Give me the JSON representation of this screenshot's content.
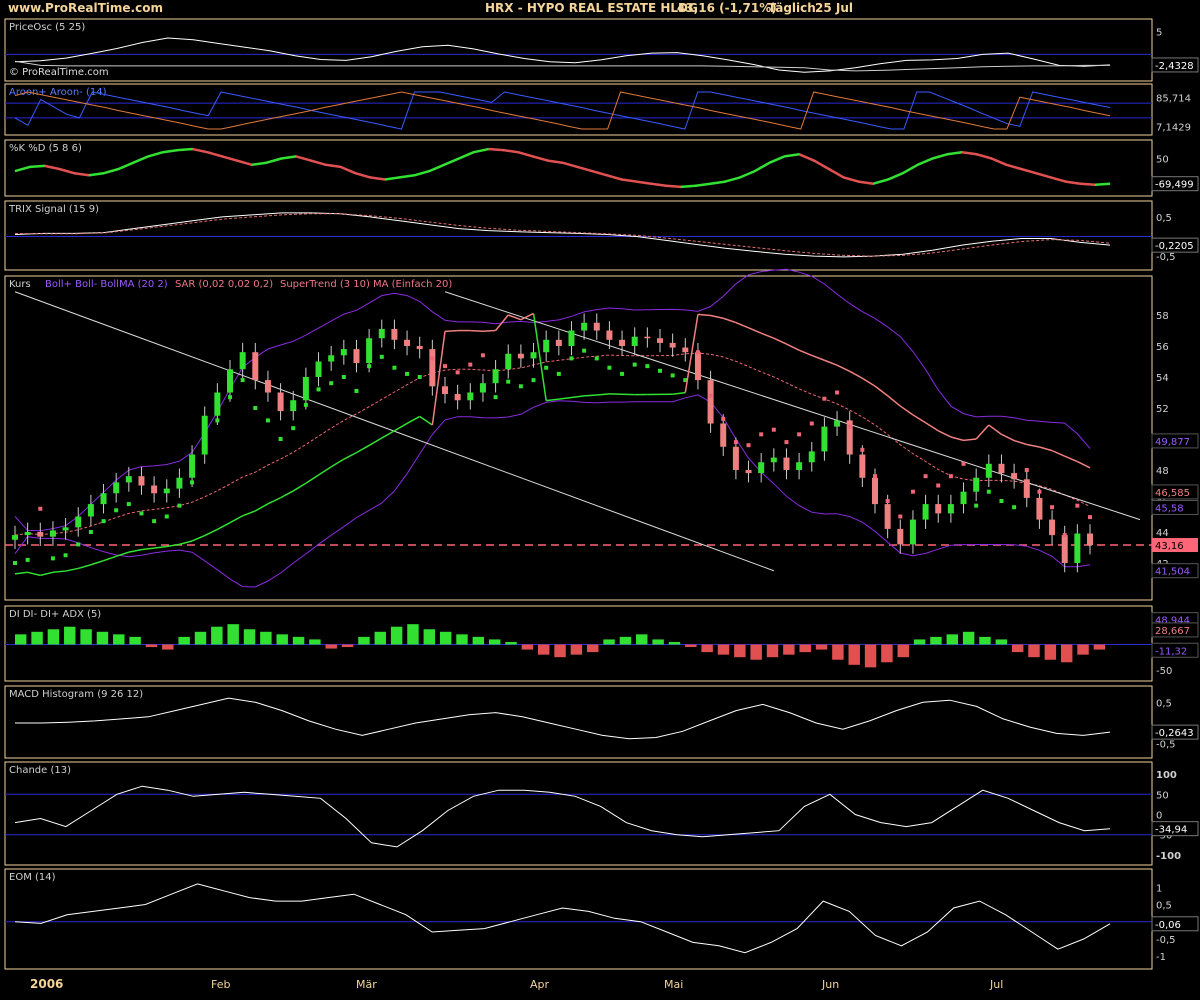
{
  "header": {
    "site": "www.ProRealTime.com",
    "title": "HRX - HYPO REAL ESTATE HLDG",
    "quote": "43,16 (-1,71%)",
    "period": "Täglich",
    "date": "25 Jul"
  },
  "x_axis": {
    "labels": [
      "2006",
      "Feb",
      "Mär",
      "Apr",
      "Mai",
      "Jun",
      "Jul"
    ]
  },
  "colors": {
    "background": "#000000",
    "frame": "#f4d49a",
    "panel_text": "#d0d0d0",
    "blue_line": "#2b2bd6",
    "green": "#31e031",
    "red": "#e05050",
    "purple": "#8a2be2",
    "white": "#ffffff",
    "sar": "#ee6677"
  },
  "chart_data": [
    {
      "id": "priceosc",
      "type": "line",
      "title": "PriceOsc (5 25)",
      "watermark": "© ProRealTime.com",
      "y_ticks": [
        "5"
      ],
      "last_value": "-2,4328",
      "ylim": [
        -4.5,
        6
      ],
      "series": [
        {
          "values": [
            -1.6,
            -1.4,
            -0.8,
            0.2,
            1.3,
            2.6,
            3.6,
            3.2,
            2.4,
            1.6,
            0.8,
            -0.3,
            -1.1,
            -1.3,
            -0.5,
            0.7,
            1.7,
            2.0,
            1.2,
            0.1,
            -0.9,
            -1.6,
            -1.8,
            -1.2,
            -0.3,
            0.3,
            0.4,
            -0.3,
            -1.2,
            -2.2,
            -3.4,
            -3.9,
            -3.6,
            -2.9,
            -2.0,
            -1.3,
            -1.2,
            -0.9,
            0.0,
            0.3,
            -1.0,
            -2.4,
            -2.6,
            -2.3
          ],
          "color": "#ffffff"
        },
        {
          "values": [
            -1.5,
            -2.4,
            -2.5,
            -2.5,
            -2.5,
            -2.5,
            -2.5,
            -2.5,
            -2.5,
            -2.5,
            -2.5,
            -2.5,
            -2.5,
            -2.5,
            -2.5,
            -2.5,
            -2.5,
            -2.5,
            -2.5,
            -2.5,
            -2.5,
            -2.5,
            -2.5,
            -2.5,
            -2.5,
            -2.5,
            -2.5,
            -2.5,
            -2.6,
            -2.7,
            -2.8,
            -2.9,
            -3.4,
            -3.6,
            -3.5,
            -3.3,
            -3.1,
            -2.9,
            -2.7,
            -2.6,
            -2.5,
            -2.5,
            -2.4,
            -2.4
          ],
          "color": "#cccccc"
        }
      ],
      "reference_lines": [
        0
      ]
    },
    {
      "id": "aroon",
      "type": "line",
      "title": "Aroon+ Aroon- (14)",
      "y_ticks": [
        "85,714",
        "7,1429"
      ],
      "ylim": [
        0,
        100
      ],
      "series": [
        {
          "name": "Aroon+",
          "values": [
            30,
            10,
            80,
            60,
            40,
            30,
            100,
            93,
            86,
            79,
            72,
            65,
            58,
            50,
            43,
            36,
            100,
            93,
            86,
            79,
            72,
            65,
            58,
            50,
            43,
            36,
            29,
            22,
            15,
            7,
            0,
            100,
            100,
            100,
            93,
            86,
            79,
            72,
            100,
            93,
            86,
            79,
            72,
            65,
            58,
            50,
            43,
            36,
            29,
            22,
            15,
            7,
            0,
            100,
            100,
            93,
            86,
            79,
            72,
            65,
            58,
            50,
            43,
            36,
            29,
            22,
            15,
            7,
            0,
            0,
            100,
            100,
            86,
            72,
            58,
            43,
            29,
            15,
            7,
            100,
            93,
            86,
            79,
            72,
            65,
            58
          ],
          "color": "#3a5aff"
        },
        {
          "name": "Aroon-",
          "values": [
            90,
            100,
            93,
            86,
            79,
            72,
            65,
            58,
            50,
            43,
            36,
            29,
            22,
            15,
            7,
            0,
            0,
            7,
            15,
            22,
            29,
            36,
            43,
            50,
            58,
            65,
            72,
            79,
            86,
            93,
            100,
            93,
            86,
            79,
            72,
            65,
            58,
            50,
            43,
            36,
            29,
            22,
            15,
            7,
            0,
            0,
            0,
            100,
            93,
            86,
            79,
            72,
            65,
            58,
            50,
            43,
            36,
            29,
            22,
            15,
            7,
            0,
            100,
            93,
            86,
            79,
            72,
            65,
            58,
            50,
            43,
            36,
            29,
            22,
            15,
            7,
            0,
            0,
            86,
            79,
            72,
            65,
            58,
            50,
            43,
            36
          ],
          "color": "#e07a3a"
        }
      ],
      "reference_lines": [
        70,
        30
      ]
    },
    {
      "id": "stoch",
      "type": "line",
      "title": "%K %D (5 8 6)",
      "y_ticks": [
        "50"
      ],
      "last_value": "-69,499",
      "ylim": [
        -100,
        100
      ],
      "series": [
        {
          "name": "%K",
          "values": [
            -10,
            10,
            15,
            0,
            -20,
            -30,
            -20,
            0,
            30,
            60,
            80,
            90,
            95,
            80,
            60,
            40,
            20,
            30,
            50,
            60,
            40,
            20,
            10,
            -20,
            -40,
            -50,
            -40,
            -30,
            -10,
            20,
            50,
            80,
            95,
            90,
            80,
            60,
            40,
            30,
            10,
            -10,
            -30,
            -50,
            -60,
            -70,
            -80,
            -85,
            -80,
            -70,
            -60,
            -40,
            -10,
            30,
            60,
            70,
            40,
            0,
            -40,
            -60,
            -70,
            -50,
            -20,
            20,
            50,
            70,
            80,
            70,
            50,
            20,
            0,
            -20,
            -40,
            -60,
            -70,
            -75,
            -70
          ],
          "color": "#ffffff"
        }
      ]
    },
    {
      "id": "trix",
      "type": "line",
      "title": "TRIX Signal (15 9)",
      "y_ticks": [
        "0,5",
        "-0,5"
      ],
      "last_value": "-0,2205",
      "ylim": [
        -0.7,
        0.7
      ],
      "series": [
        {
          "name": "TRIX",
          "values": [
            0.05,
            0.08,
            0.08,
            0.1,
            0.2,
            0.3,
            0.4,
            0.5,
            0.55,
            0.6,
            0.6,
            0.58,
            0.5,
            0.4,
            0.3,
            0.2,
            0.15,
            0.12,
            0.1,
            0.08,
            0.05,
            0.0,
            -0.1,
            -0.2,
            -0.3,
            -0.38,
            -0.45,
            -0.5,
            -0.52,
            -0.5,
            -0.45,
            -0.35,
            -0.22,
            -0.12,
            -0.05,
            -0.05,
            -0.15,
            -0.22
          ],
          "color": "#ffffff"
        },
        {
          "name": "Signal",
          "values": [
            0.08,
            0.07,
            0.07,
            0.09,
            0.17,
            0.26,
            0.35,
            0.44,
            0.5,
            0.55,
            0.58,
            0.58,
            0.53,
            0.46,
            0.37,
            0.28,
            0.21,
            0.16,
            0.13,
            0.1,
            0.07,
            0.03,
            -0.04,
            -0.12,
            -0.2,
            -0.28,
            -0.36,
            -0.43,
            -0.48,
            -0.5,
            -0.48,
            -0.42,
            -0.32,
            -0.22,
            -0.13,
            -0.08,
            -0.1,
            -0.17
          ],
          "color": "#e07070"
        }
      ],
      "reference_lines": [
        0
      ]
    },
    {
      "id": "price",
      "type": "candlestick",
      "title": "Kurs",
      "legend": [
        "Boll+ Boll- BollMA (20 2)",
        "SAR (0,02 0,02 0,2)",
        "SuperTrend (3 10)",
        "MA (Einfach 20)"
      ],
      "y_ticks": [
        "58",
        "56",
        "54",
        "52",
        "50",
        "48",
        "46",
        "44",
        "42"
      ],
      "value_labels": [
        "49,877",
        "46,585",
        "45,58",
        "43,16",
        "41,504"
      ],
      "ylim": [
        40,
        60
      ],
      "close": [
        43.8,
        44.0,
        43.7,
        44.1,
        44.3,
        45.0,
        45.8,
        46.5,
        47.2,
        47.6,
        47.0,
        46.5,
        46.8,
        47.5,
        49.0,
        51.5,
        53.0,
        54.5,
        55.6,
        53.8,
        53.0,
        51.8,
        52.5,
        54.0,
        55.0,
        55.4,
        55.8,
        54.9,
        56.5,
        57.1,
        56.4,
        56.0,
        55.8,
        53.4,
        52.9,
        52.5,
        53.0,
        53.6,
        54.5,
        55.5,
        55.2,
        55.6,
        56.4,
        56.0,
        57.0,
        57.5,
        57.0,
        56.4,
        56.0,
        56.6,
        56.5,
        56.2,
        55.9,
        55.6,
        53.8,
        51.0,
        49.5,
        48.0,
        47.8,
        48.5,
        48.8,
        48.0,
        48.5,
        49.2,
        50.8,
        51.2,
        49.0,
        47.5,
        45.8,
        44.2,
        43.2,
        44.8,
        45.8,
        45.2,
        45.8,
        46.6,
        47.5,
        48.4,
        47.8,
        47.4,
        46.2,
        44.8,
        43.8,
        42.0,
        43.9,
        43.16
      ],
      "reference_lines": [
        43.16
      ],
      "reference_lines_note": "dashed line at last close"
    },
    {
      "id": "dmi",
      "type": "bar",
      "title": "DI DI- DI+ ADX (5)",
      "y_ticks": [
        "50",
        "-50"
      ],
      "value_labels": [
        "48,944",
        "28,667",
        "-11,32"
      ],
      "ylim": [
        -60,
        60
      ],
      "values": [
        20,
        25,
        30,
        35,
        30,
        25,
        20,
        15,
        -5,
        -10,
        15,
        25,
        35,
        40,
        30,
        25,
        20,
        15,
        10,
        -8,
        -5,
        15,
        25,
        35,
        40,
        30,
        25,
        20,
        15,
        10,
        5,
        -10,
        -20,
        -25,
        -20,
        -15,
        10,
        15,
        20,
        10,
        5,
        -5,
        -15,
        -20,
        -25,
        -30,
        -25,
        -20,
        -15,
        -10,
        -30,
        -40,
        -45,
        -35,
        -25,
        10,
        15,
        20,
        25,
        15,
        10,
        -15,
        -25,
        -30,
        -35,
        -20,
        -10
      ]
    },
    {
      "id": "macd",
      "type": "line",
      "title": "MACD Histogram (9 26 12)",
      "y_ticks": [
        "0,5",
        "-0,5"
      ],
      "last_value": "-0,2643",
      "ylim": [
        -0.7,
        0.7
      ],
      "series": [
        {
          "values": [
            0.0,
            0.0,
            0.02,
            0.05,
            0.1,
            0.15,
            0.3,
            0.45,
            0.6,
            0.5,
            0.3,
            0.05,
            -0.15,
            -0.3,
            -0.15,
            0.0,
            0.1,
            0.2,
            0.25,
            0.15,
            0.0,
            -0.15,
            -0.3,
            -0.38,
            -0.35,
            -0.2,
            0.05,
            0.3,
            0.45,
            0.25,
            0.0,
            -0.15,
            0.05,
            0.3,
            0.5,
            0.55,
            0.4,
            0.1,
            -0.1,
            -0.25,
            -0.3,
            -0.22
          ],
          "color": "#ffffff"
        }
      ]
    },
    {
      "id": "chande",
      "type": "line",
      "title": "Chande (13)",
      "y_ticks": [
        "100",
        "50",
        "0",
        "-50",
        "-100"
      ],
      "last_value": "-34,94",
      "ylim": [
        -110,
        110
      ],
      "series": [
        {
          "values": [
            -20,
            -10,
            -30,
            10,
            50,
            70,
            60,
            45,
            50,
            55,
            50,
            45,
            40,
            -10,
            -70,
            -80,
            -40,
            10,
            45,
            60,
            60,
            55,
            45,
            20,
            -20,
            -40,
            -50,
            -55,
            -50,
            -45,
            -40,
            20,
            50,
            0,
            -20,
            -30,
            -20,
            20,
            60,
            40,
            10,
            -20,
            -40,
            -35
          ],
          "color": "#ffffff"
        }
      ],
      "reference_lines": [
        50,
        -50
      ]
    },
    {
      "id": "eom",
      "type": "line",
      "title": "EOM (14)",
      "y_ticks": [
        "1",
        "0,5",
        "0",
        "-0,5",
        "-1"
      ],
      "last_value": "-0,06",
      "ylim": [
        -1.2,
        1.3
      ],
      "series": [
        {
          "values": [
            0.0,
            -0.05,
            0.2,
            0.3,
            0.4,
            0.5,
            0.8,
            1.1,
            0.9,
            0.7,
            0.6,
            0.6,
            0.7,
            0.8,
            0.5,
            0.2,
            -0.3,
            -0.25,
            -0.2,
            0.0,
            0.2,
            0.4,
            0.3,
            0.1,
            0.0,
            -0.3,
            -0.6,
            -0.7,
            -0.9,
            -0.6,
            -0.2,
            0.6,
            0.3,
            -0.4,
            -0.7,
            -0.3,
            0.4,
            0.6,
            0.2,
            -0.3,
            -0.8,
            -0.5,
            -0.06
          ],
          "color": "#ffffff"
        }
      ],
      "reference_lines": [
        0
      ]
    }
  ]
}
